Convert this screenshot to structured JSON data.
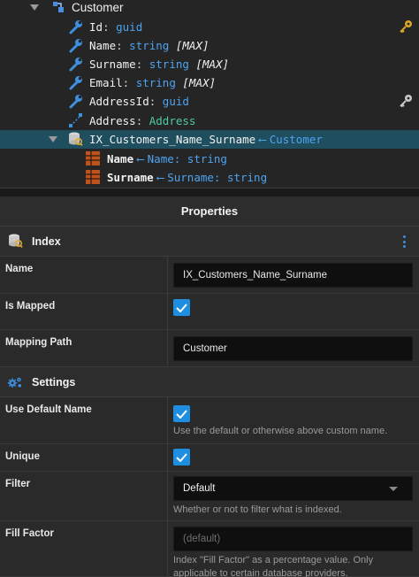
{
  "tree": {
    "customer": {
      "label": "Customer"
    },
    "id": {
      "name": "Id",
      "sep": ": ",
      "type": "guid"
    },
    "name": {
      "name": "Name",
      "sep": ": ",
      "type": "string",
      "max": "[MAX]"
    },
    "surname": {
      "name": "Surname",
      "sep": ": ",
      "type": "string",
      "max": "[MAX]"
    },
    "email": {
      "name": "Email",
      "sep": ": ",
      "type": "string",
      "max": "[MAX]"
    },
    "address_id": {
      "name": "AddressId",
      "sep": ": ",
      "type": "guid"
    },
    "address": {
      "name": "Address",
      "sep": ": ",
      "type": "Address"
    },
    "index": {
      "name": "IX_Customers_Name_Surname",
      "arrow": "⟵",
      "target": "Customer"
    },
    "col_name": {
      "name": "Name",
      "arrow": "⟵",
      "target": "Name: string"
    },
    "col_surname": {
      "name": "Surname",
      "arrow": "⟵",
      "target": "Surname: string"
    }
  },
  "properties": {
    "title": "Properties",
    "index_section": {
      "label": "Index"
    },
    "name": {
      "label": "Name",
      "value": "IX_Customers_Name_Surname"
    },
    "is_mapped": {
      "label": "Is Mapped",
      "checked": true
    },
    "mapping_path": {
      "label": "Mapping Path",
      "value": "Customer"
    },
    "settings_section": {
      "label": "Settings"
    },
    "use_default_name": {
      "label": "Use Default Name",
      "checked": true,
      "help": "Use the default or otherwise above custom name."
    },
    "unique": {
      "label": "Unique",
      "checked": true
    },
    "filter": {
      "label": "Filter",
      "value": "Default",
      "help": "Whether or not to filter what is indexed."
    },
    "fill_factor": {
      "label": "Fill Factor",
      "placeholder": "(default)",
      "help": "Index \"Fill Factor\" as a percentage value. Only applicable to certain database providers."
    }
  },
  "colors": {
    "accent": "#1e8fe0",
    "type_text": "#4ea3f0",
    "assoc_text": "#4ec9a6",
    "selected_row": "#1f4e5f"
  },
  "icons": [
    "class-icon",
    "attribute-wrench-icon",
    "key-icon",
    "association-icon",
    "index-icon",
    "column-icon",
    "checkbox-checked-icon",
    "kebab-menu-icon",
    "settings-gears-icon",
    "chevron-down-icon"
  ]
}
